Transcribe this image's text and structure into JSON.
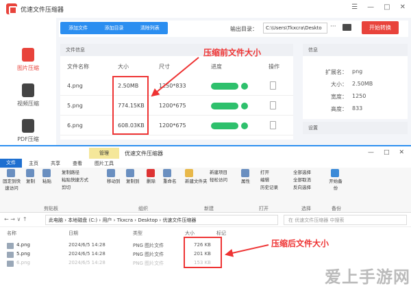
{
  "app": {
    "title": "优速文件压缩器",
    "window_controls": [
      "☰",
      "—",
      "□",
      "✕"
    ],
    "sidebar": [
      {
        "label": "图片压缩",
        "active": true
      },
      {
        "label": "视频压缩",
        "active": false
      },
      {
        "label": "PDF压缩",
        "active": false
      }
    ],
    "toolbar": {
      "add_file": "添加文件",
      "add_dir": "添加目录",
      "clear_list": "清除列表",
      "output_label": "输出目录：",
      "output_path": "C:\\Users\\Tkxcra\\Deskto",
      "browse": "···",
      "start": "开始转换"
    },
    "file_panel": {
      "title": "文件信息",
      "columns": [
        "文件名称",
        "大小",
        "尺寸",
        "进度",
        "操作"
      ],
      "rows": [
        {
          "name": "4.png",
          "size": "2.50MB",
          "dim": "1250*833"
        },
        {
          "name": "5.png",
          "size": "774.15KB",
          "dim": "1200*675"
        },
        {
          "name": "6.png",
          "size": "608.03KB",
          "dim": "1200*675"
        }
      ]
    },
    "info_panel": {
      "title": "信息",
      "rows": [
        {
          "k": "扩展名：",
          "v": "png"
        },
        {
          "k": "大小：",
          "v": "2.50MB"
        },
        {
          "k": "宽度：",
          "v": "1250"
        },
        {
          "k": "高度：",
          "v": "833"
        }
      ],
      "settings": "设置"
    },
    "annotation_before": "压缩前文件大小"
  },
  "explorer": {
    "manage": "管理",
    "title": "优速文件压缩器",
    "controls": [
      "—",
      "□",
      "✕"
    ],
    "tabs": [
      "文件",
      "主页",
      "共享",
      "查看",
      "图片工具"
    ],
    "ribbon": {
      "clipboard": {
        "pin": "固定到快速访问",
        "copy": "复制",
        "paste": "粘贴",
        "copy_path": "复制路径",
        "paste_shortcut": "粘贴快捷方式",
        "cut": "剪切",
        "label": "剪贴板"
      },
      "organize": {
        "move": "移动到",
        "copyto": "复制到",
        "delete": "删除",
        "rename": "重命名",
        "label": "组织"
      },
      "new": {
        "folder": "新建文件夹",
        "item": "新建项目",
        "easy": "轻松访问",
        "label": "新建"
      },
      "open": {
        "props": "属性",
        "open": "打开",
        "edit": "编辑",
        "history": "历史记录",
        "label": "打开"
      },
      "select": {
        "all": "全部选择",
        "none": "全部取消",
        "invert": "反向选择",
        "label": "选择"
      },
      "backup": {
        "start": "开始备份",
        "label": "备份"
      }
    },
    "address": [
      "此电脑",
      "本地磁盘 (C:)",
      "用户",
      "Tkxcra",
      "Desktop",
      "优速文件压缩器"
    ],
    "search_placeholder": "在 优速文件压缩器 中搜索",
    "columns": [
      "名称",
      "日期",
      "类型",
      "大小",
      "标记"
    ],
    "files": [
      {
        "name": "4.png",
        "date": "2024/6/5 14:28",
        "type": "PNG 图片文件",
        "size": "726 KB"
      },
      {
        "name": "5.png",
        "date": "2024/6/5 14:28",
        "type": "PNG 图片文件",
        "size": "201 KB"
      },
      {
        "name": "6.png",
        "date": "2024/6/5 14:28",
        "type": "PNG 图片文件",
        "size": "153 KB"
      }
    ],
    "annotation_after": "压缩后文件大小"
  },
  "watermark": "爱上手游网",
  "colors": {
    "accent": "#e8433b",
    "blue": "#2b8ef0",
    "green": "#2ec06c",
    "annotation": "#e33333"
  }
}
